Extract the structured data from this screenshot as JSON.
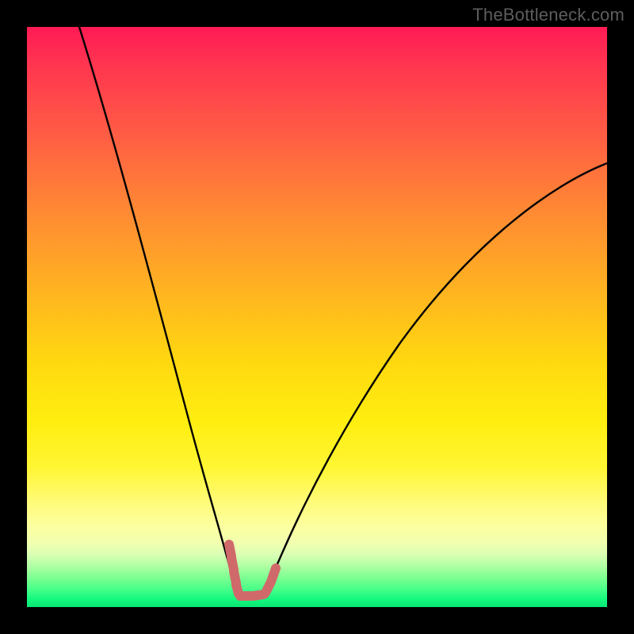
{
  "watermark": "TheBottleneck.com",
  "colors": {
    "frame": "#000000",
    "curve": "#000000",
    "marker": "#d06a6a",
    "gradient_top": "#ff1a55",
    "gradient_bottom": "#07e874"
  },
  "chart_data": {
    "type": "line",
    "title": "",
    "xlabel": "",
    "ylabel": "",
    "xlim": [
      0,
      100
    ],
    "ylim": [
      0,
      100
    ],
    "series": [
      {
        "name": "bottleneck-curve-left",
        "x": [
          9,
          12,
          15,
          18,
          21,
          24,
          26,
          28,
          30,
          32,
          33.5,
          34.5,
          35.2,
          35.8
        ],
        "y": [
          100,
          88,
          75,
          62,
          49,
          37,
          27,
          19,
          12,
          7,
          4,
          2.5,
          2,
          2
        ]
      },
      {
        "name": "bottleneck-curve-right",
        "x": [
          36,
          36.5,
          37.5,
          39,
          41,
          44,
          48,
          53,
          59,
          66,
          74,
          83,
          92,
          100
        ],
        "y": [
          2,
          2.2,
          3,
          5,
          8,
          13,
          20,
          28,
          37,
          46,
          55,
          63,
          70,
          76
        ]
      },
      {
        "name": "markers",
        "x": [
          32.8,
          33.2,
          33.6,
          34,
          34.6,
          35.4,
          36.2,
          37,
          37.6,
          38.2,
          38.5,
          38.7
        ],
        "y": [
          7.5,
          6,
          4.8,
          3.8,
          2.8,
          2.2,
          2.2,
          2.4,
          3,
          4,
          5.2,
          6.5
        ]
      }
    ]
  }
}
